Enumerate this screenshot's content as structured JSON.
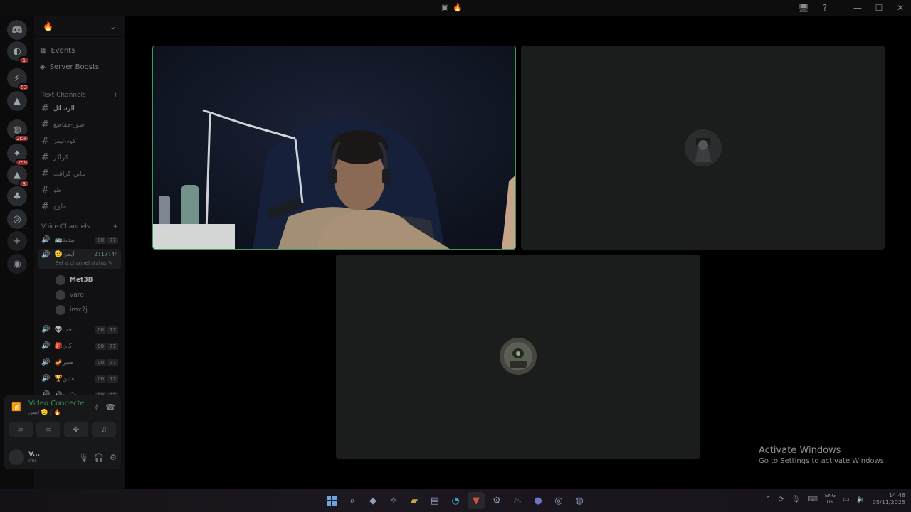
{
  "titlebar": {
    "icon_glyph": "▣",
    "server_glyph": "🔥",
    "ctrl_glyphs": {
      "inbox": "🖥",
      "help": "?",
      "minimize": "—",
      "maximize": "☐",
      "close": "✕"
    }
  },
  "rail": {
    "servers": [
      {
        "glyph": "◐",
        "badge": "1"
      },
      {
        "glyph": "⚡",
        "badge": "83"
      },
      {
        "glyph": "▲",
        "badge": ""
      },
      {
        "glyph": "◍",
        "badge": "2K+"
      },
      {
        "glyph": "✦",
        "badge": "259"
      },
      {
        "glyph": "▲",
        "badge": "3"
      },
      {
        "glyph": "♣",
        "badge": ""
      },
      {
        "glyph": "◎",
        "badge": ""
      }
    ],
    "add_glyph": "+",
    "discover_glyph": "◉"
  },
  "sidebar": {
    "server_name": "🔥",
    "chevron": "⌄",
    "events_label": "Events",
    "boosts_label": "Server Boosts",
    "text_category": "Text Channels",
    "voice_category": "Voice Channels",
    "text_channels": [
      "الرسائل",
      "صور-مقاطع",
      "كود-تيمز",
      "كراكر",
      "ماين-كرافت",
      "ظو",
      "ملوح"
    ],
    "voice_channels_top": [
      {
        "name": "🚌بيدية",
        "c1": "00",
        "c2": "77"
      }
    ],
    "active_voice": {
      "name": "🫡ايمن",
      "timer": "2:17:44",
      "status": "Set a channel status ✎"
    },
    "voice_users": [
      {
        "name": "Met3B",
        "bold": true
      },
      {
        "name": "varo",
        "bold": false
      },
      {
        "name": "imx7j",
        "bold": false
      }
    ],
    "voice_channels_bottom": [
      {
        "name": "👽لعب",
        "c1": "00",
        "c2": "77"
      },
      {
        "name": "🎒اكان",
        "c1": "00",
        "c2": "77"
      },
      {
        "name": "🪔متبر",
        "c1": "00",
        "c2": "77"
      },
      {
        "name": "🏆ماين",
        "c1": "00",
        "c2": "77"
      },
      {
        "name": "🔊مذاكره",
        "c1": "00",
        "c2": "77"
      }
    ]
  },
  "voice_panel": {
    "title": "Video Connecte",
    "subtitle": "ايمن 🫡 / 🔥",
    "user_name": "V...",
    "user_status": "Inv..."
  },
  "activate": {
    "title": "Activate Windows",
    "subtitle": "Go to Settings to activate Windows."
  },
  "taskbar": {
    "lang_top": "ENG",
    "lang_bottom": "UK",
    "time": "14:48",
    "date": "05/11/2025"
  }
}
